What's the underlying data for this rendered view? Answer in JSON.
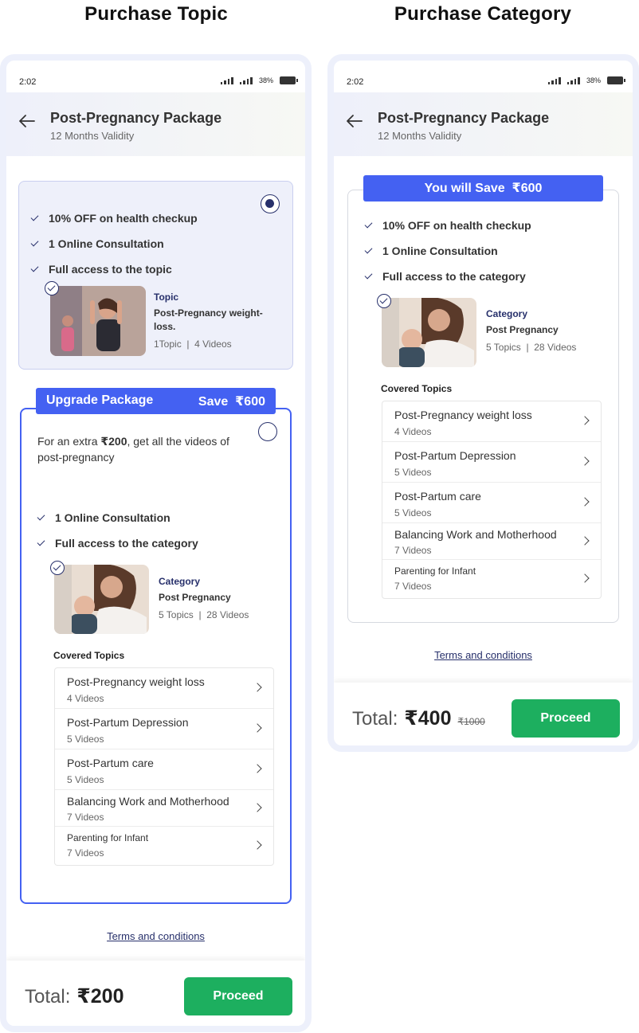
{
  "headings": {
    "left": "Purchase Topic",
    "right": "Purchase Category"
  },
  "colors": {
    "accent": "#4461f2",
    "navy": "#27306b",
    "green": "#1daf5f",
    "selected_bg": "#eef0fa"
  },
  "status": {
    "time": "2:02",
    "battery": "38%"
  },
  "header": {
    "title": "Post-Pregnancy Package",
    "subtitle": "12 Months Validity",
    "back_icon": "arrow-left-icon"
  },
  "topic_screen": {
    "option": {
      "selected": true,
      "features": [
        "10% OFF on health checkup",
        "1 Online Consultation",
        "Full access to the topic"
      ],
      "item": {
        "kind": "Topic",
        "name": "Post-Pregnancy weight-loss.",
        "stats": "1Topic  |  4 Videos"
      }
    },
    "upgrade": {
      "banner_label": "Upgrade Package",
      "banner_save": "Save  ₹600",
      "selected": false,
      "offer_prefix": "For an extra ",
      "offer_amount": "₹200",
      "offer_suffix": ", get all the videos of",
      "offer_line2": "post-pregnancy",
      "features": [
        "1 Online Consultation",
        "Full access to the category"
      ],
      "item": {
        "kind": "Category",
        "name": "Post Pregnancy",
        "stats": "5 Topics  |  28 Videos"
      }
    },
    "terms": "Terms and conditions",
    "total_label": "Total:",
    "total_amount": "₹200",
    "proceed": "Proceed"
  },
  "category_screen": {
    "save_banner": "You will Save  ₹600",
    "features": [
      "10% OFF on health checkup",
      "1 Online Consultation",
      "Full access to the category"
    ],
    "item": {
      "kind": "Category",
      "name": "Post Pregnancy",
      "stats": "5 Topics  |  28 Videos"
    },
    "terms": "Terms and conditions",
    "total_label": "Total:",
    "total_amount": "₹400",
    "total_original": "₹1000",
    "proceed": "Proceed"
  },
  "covered_topics": {
    "title": "Covered Topics",
    "items": [
      {
        "name": "Post-Pregnancy weight loss",
        "count": "4 Videos"
      },
      {
        "name": "Post-Partum Depression",
        "count": "5 Videos"
      },
      {
        "name": "Post-Partum care",
        "count": "5 Videos"
      },
      {
        "name": "Balancing Work and Motherhood",
        "count": "7 Videos"
      },
      {
        "name": "Parenting for Infant",
        "count": "7 Videos"
      }
    ]
  }
}
